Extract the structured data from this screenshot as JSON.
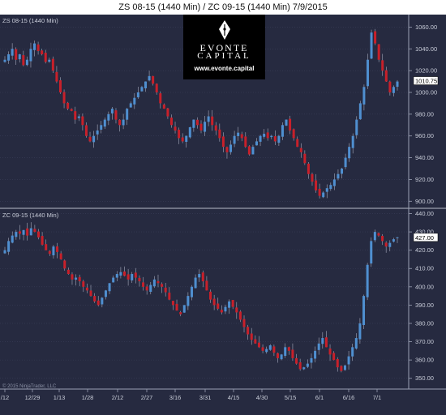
{
  "header": {
    "title": "ZS 08-15 (1440 Min) / ZC 09-15 (1440 Min)  7/9/2015"
  },
  "logo": {
    "line1": "EVONTE",
    "line2": "CAPITAL",
    "url": "www.evonte.capital"
  },
  "copyright": "© 2015 NinjaTrader, LLC",
  "colors": {
    "up": "#4f8fd0",
    "down": "#c8202a",
    "background": "#262a40",
    "grid": "#3a3f58",
    "text": "#c8ccd8"
  },
  "chart_data": [
    {
      "type": "candlestick",
      "title": "ZS 08-15 (1440 Min)",
      "y_ticks": [
        900,
        920,
        940,
        960,
        980,
        1000,
        1020,
        1040,
        1060
      ],
      "ylim": [
        895,
        1070
      ],
      "last_value_label": "1010.75",
      "last_value": 1010.75,
      "close": [
        1030,
        1035,
        1040,
        1030,
        1035,
        1025,
        1030,
        1040,
        1045,
        1038,
        1035,
        1028,
        1030,
        1020,
        1010,
        1000,
        990,
        985,
        983,
        975,
        978,
        970,
        960,
        955,
        960,
        965,
        970,
        975,
        980,
        985,
        975,
        970,
        975,
        985,
        990,
        995,
        1000,
        1005,
        1010,
        1015,
        1008,
        1000,
        990,
        985,
        978,
        970,
        965,
        958,
        955,
        960,
        968,
        975,
        970,
        965,
        973,
        978,
        970,
        965,
        958,
        950,
        945,
        952,
        960,
        963,
        958,
        950,
        943,
        950,
        955,
        960,
        962,
        958,
        960,
        955,
        960,
        970,
        975,
        965,
        958,
        950,
        945,
        935,
        925,
        918,
        910,
        905,
        908,
        912,
        915,
        920,
        925,
        930,
        940,
        950,
        960,
        975,
        990,
        1005,
        1030,
        1055,
        1045,
        1030,
        1020,
        1010,
        1000,
        1005,
        1010
      ]
    },
    {
      "type": "candlestick",
      "title": "ZC 09-15 (1440 Min)",
      "y_ticks": [
        350,
        360,
        370,
        380,
        390,
        400,
        410,
        420,
        430,
        440
      ],
      "ylim": [
        345,
        442
      ],
      "last_value_label": "427.00",
      "last_value": 427.0,
      "close": [
        420,
        425,
        428,
        430,
        429,
        431,
        428,
        432,
        430,
        427,
        423,
        420,
        418,
        422,
        419,
        415,
        410,
        407,
        404,
        405,
        403,
        400,
        398,
        395,
        392,
        390,
        394,
        398,
        402,
        405,
        407,
        408,
        406,
        404,
        407,
        405,
        403,
        400,
        398,
        401,
        404,
        402,
        400,
        397,
        393,
        390,
        387,
        385,
        390,
        395,
        400,
        405,
        407,
        403,
        398,
        393,
        390,
        388,
        386,
        389,
        392,
        389,
        386,
        382,
        378,
        374,
        371,
        369,
        367,
        365,
        366,
        368,
        364,
        361,
        363,
        367,
        365,
        361,
        358,
        355,
        356,
        358,
        361,
        365,
        369,
        372,
        367,
        363,
        360,
        356,
        354,
        357,
        362,
        367,
        372,
        380,
        395,
        412,
        425,
        430,
        428,
        425,
        422,
        424,
        426,
        427
      ]
    }
  ],
  "x_axis": {
    "ticks": [
      "/12",
      "12/29",
      "1/13",
      "1/28",
      "2/12",
      "2/27",
      "3/16",
      "3/31",
      "4/15",
      "4/30",
      "5/15",
      "6/1",
      "6/16",
      "7/1"
    ]
  }
}
